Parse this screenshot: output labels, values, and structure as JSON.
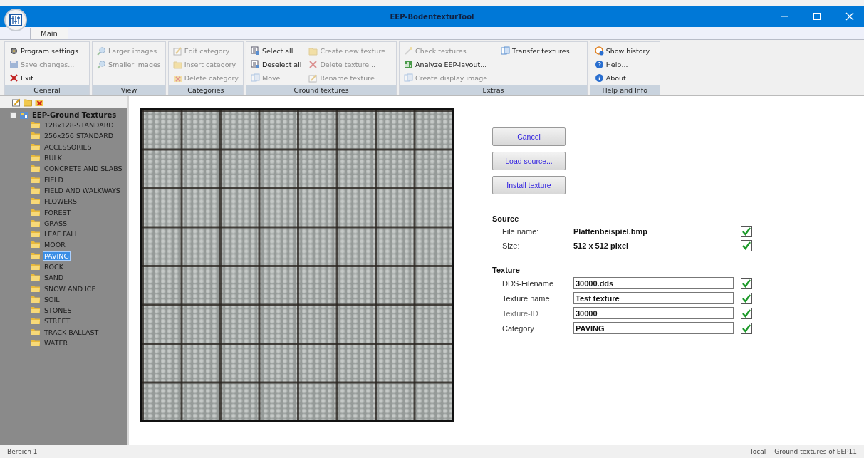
{
  "window": {
    "title": "EEP-BodentexturTool"
  },
  "tabs": [
    {
      "label": "Main",
      "selected": true
    }
  ],
  "ribbon": {
    "groups": [
      {
        "label": "General",
        "columns": [
          [
            {
              "label": "Program settings...",
              "disabled": false
            },
            {
              "label": "Save changes...",
              "disabled": true
            },
            {
              "label": "Exit",
              "disabled": false
            }
          ]
        ]
      },
      {
        "label": "View",
        "columns": [
          [
            {
              "label": "Larger images",
              "disabled": true
            },
            {
              "label": "Smaller images",
              "disabled": true
            }
          ]
        ]
      },
      {
        "label": "Categories",
        "columns": [
          [
            {
              "label": "Edit category",
              "disabled": true
            },
            {
              "label": "Insert category",
              "disabled": true
            },
            {
              "label": "Delete category",
              "disabled": true
            }
          ]
        ]
      },
      {
        "label": "Ground textures",
        "columns": [
          [
            {
              "label": "Select all",
              "disabled": false
            },
            {
              "label": "Deselect all",
              "disabled": false
            },
            {
              "label": "Move...",
              "disabled": true
            }
          ],
          [
            {
              "label": "Create new texture...",
              "disabled": true
            },
            {
              "label": "Delete texture...",
              "disabled": true
            },
            {
              "label": "Rename texture...",
              "disabled": true
            }
          ]
        ]
      },
      {
        "label": "Extras",
        "columns": [
          [
            {
              "label": "Check textures...",
              "disabled": true
            },
            {
              "label": "Analyze EEP-layout...",
              "disabled": false
            },
            {
              "label": "Create display image...",
              "disabled": true
            }
          ],
          [
            {
              "label": "Transfer textures......",
              "disabled": false
            }
          ]
        ]
      },
      {
        "label": "Help and Info",
        "columns": [
          [
            {
              "label": "Show history...",
              "disabled": false
            },
            {
              "label": "Help...",
              "disabled": false
            },
            {
              "label": "About...",
              "disabled": false
            }
          ]
        ]
      }
    ]
  },
  "tree": {
    "label": "EEP-Ground Textures",
    "expanded": true,
    "children": [
      {
        "label": "128x128-STANDARD",
        "selected": false
      },
      {
        "label": "256x256 STANDARD",
        "selected": false
      },
      {
        "label": "ACCESSORIES",
        "selected": false
      },
      {
        "label": "BULK",
        "selected": false
      },
      {
        "label": "CONCRETE AND SLABS",
        "selected": false
      },
      {
        "label": "FIELD",
        "selected": false
      },
      {
        "label": "FIELD AND WALKWAYS",
        "selected": false
      },
      {
        "label": "FLOWERS",
        "selected": false
      },
      {
        "label": "FOREST",
        "selected": false
      },
      {
        "label": "GRASS",
        "selected": false
      },
      {
        "label": "LEAF FALL",
        "selected": false
      },
      {
        "label": "MOOR",
        "selected": false
      },
      {
        "label": "PAVING",
        "selected": true
      },
      {
        "label": "ROCK",
        "selected": false
      },
      {
        "label": "SAND",
        "selected": false
      },
      {
        "label": "SNOW AND ICE",
        "selected": false
      },
      {
        "label": "SOIL",
        "selected": false
      },
      {
        "label": "STONES",
        "selected": false
      },
      {
        "label": "STREET",
        "selected": false
      },
      {
        "label": "TRACK BALLAST",
        "selected": false
      },
      {
        "label": "WATER",
        "selected": false
      }
    ]
  },
  "actions": [
    {
      "label": "Cancel"
    },
    {
      "label": "Load source..."
    },
    {
      "label": "Install texture"
    }
  ],
  "source": {
    "heading": "Source",
    "rows": [
      {
        "label": "File name:",
        "value": "Plattenbeispiel.bmp",
        "checked": true
      },
      {
        "label": "Size:",
        "value": "512 x 512 pixel",
        "checked": true
      }
    ]
  },
  "texture": {
    "heading": "Texture",
    "fields": [
      {
        "label": "DDS-Filename",
        "value": "30000.dds",
        "disabled": false,
        "checked": true
      },
      {
        "label": "Texture name",
        "value": "Test texture",
        "disabled": false,
        "checked": true
      },
      {
        "label": "Texture-ID",
        "value": "30000",
        "disabled": true,
        "checked": true
      },
      {
        "label": "Category",
        "value": "PAVING",
        "disabled": false,
        "checked": true
      }
    ]
  },
  "status_bar": {
    "left": "Bereich 1",
    "right": [
      "local",
      "Ground textures of EEP11"
    ]
  }
}
